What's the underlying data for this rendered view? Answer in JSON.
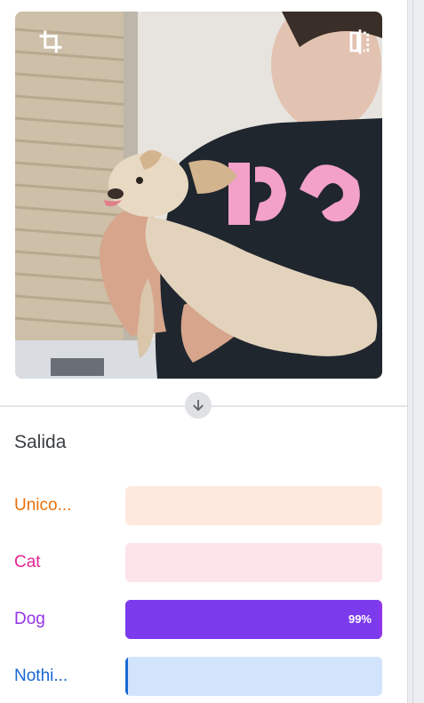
{
  "preview": {
    "crop_icon": "crop-icon",
    "flip_icon": "flip-icon",
    "shirt_logo_text": "Ψ"
  },
  "arrow_icon": "arrow-down-icon",
  "output": {
    "title": "Salida",
    "classes": [
      {
        "label": "Unico...",
        "confidence": 0.0,
        "confidence_text": "",
        "label_color": "#e8710a",
        "track_color": "#fde9dd",
        "fill_color": "#e8710a"
      },
      {
        "label": "Cat",
        "confidence": 0.0,
        "confidence_text": "",
        "label_color": "#e52592",
        "track_color": "#fde4ea",
        "fill_color": "#e52592"
      },
      {
        "label": "Dog",
        "confidence": 0.99,
        "confidence_text": "99%",
        "label_color": "#9334e6",
        "track_color": "#9334e6",
        "fill_color": "#7c3aed"
      },
      {
        "label": "Nothi...",
        "confidence": 0.01,
        "confidence_text": "",
        "label_color": "#1967d2",
        "track_color": "#d2e3fc",
        "fill_color": "#1967d2"
      }
    ]
  }
}
